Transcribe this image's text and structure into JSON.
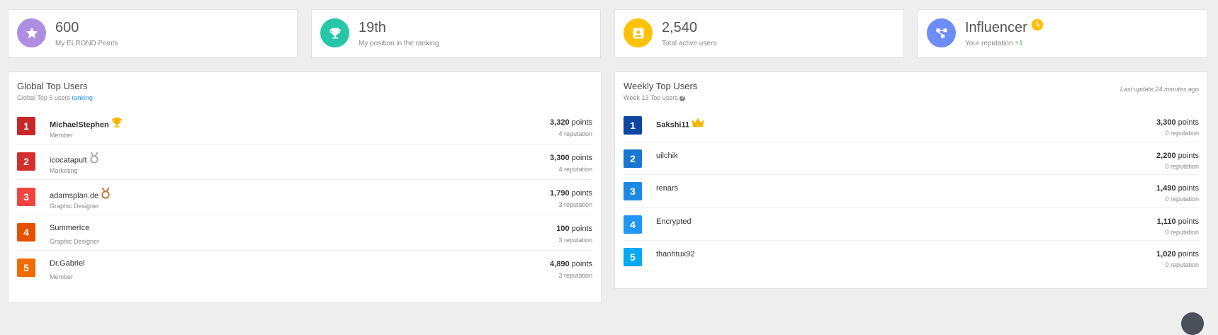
{
  "stats": [
    {
      "value": "600",
      "label": "My ELROND Points",
      "color": "#ae8ee0",
      "icon": "star-icon"
    },
    {
      "value": "19th",
      "label": "My position in the ranking",
      "color": "#26c6a6",
      "icon": "trophy-icon"
    },
    {
      "value": "2,540",
      "label": "Total active users",
      "color": "#ffc107",
      "icon": "user-icon"
    },
    {
      "value": "Influencer",
      "label": "Your reputation",
      "delta": "+1",
      "color": "#6d8cf7",
      "icon": "hierarchy-icon",
      "badge_icon": "clock-icon"
    }
  ],
  "global": {
    "title": "Global Top Users",
    "subtitle_prefix": "Global Top 5 users",
    "subtitle_link": "ranking",
    "users": [
      {
        "rank": "1",
        "name": "MichaelStephen",
        "role": "Member",
        "points": "3,320",
        "points_unit": "points",
        "reputation": "4 reputation",
        "color": "#c62828",
        "icon": "trophy-icon",
        "icon_color": "#f5b400"
      },
      {
        "rank": "2",
        "name": "icocatapult",
        "role": "Marketing",
        "points": "3,300",
        "points_unit": "points",
        "reputation": "4 reputation",
        "color": "#d32f2f",
        "icon": "medal-silver-icon",
        "icon_color": "#aaaaaa"
      },
      {
        "rank": "3",
        "name": "adamsplan.de",
        "role": "Graphic Designer",
        "points": "1,790",
        "points_unit": "points",
        "reputation": "3 reputation",
        "color": "#f4433f",
        "icon": "medal-bronze-icon",
        "icon_color": "#c07a3b"
      },
      {
        "rank": "4",
        "name": "SummerIce",
        "role": "Graphic Designer",
        "points": "100",
        "points_unit": "points",
        "reputation": "3 reputation",
        "color": "#e65100",
        "icon": "",
        "icon_color": ""
      },
      {
        "rank": "5",
        "name": "Dr.Gabriel",
        "role": "Member",
        "points": "4,890",
        "points_unit": "points",
        "reputation": "2 reputation",
        "color": "#ef6c00",
        "icon": "",
        "icon_color": ""
      }
    ]
  },
  "weekly": {
    "title": "Weekly Top Users",
    "subtitle": "Week 13 Top users",
    "last_update": "Last update 24 minutes ago",
    "users": [
      {
        "rank": "1",
        "name": "Sakshi11",
        "points": "3,300",
        "points_unit": "points",
        "reputation": "0 reputation",
        "color": "#0d47a1",
        "icon": "crown-icon",
        "icon_color": "#f5b400"
      },
      {
        "rank": "2",
        "name": "uilchik",
        "points": "2,200",
        "points_unit": "points",
        "reputation": "0 reputation",
        "color": "#1976d2",
        "icon": "",
        "icon_color": ""
      },
      {
        "rank": "3",
        "name": "renars",
        "points": "1,490",
        "points_unit": "points",
        "reputation": "0 reputation",
        "color": "#1e88e5",
        "icon": "",
        "icon_color": ""
      },
      {
        "rank": "4",
        "name": "Encrypted",
        "points": "1,110",
        "points_unit": "points",
        "reputation": "0 reputation",
        "color": "#2196f3",
        "icon": "",
        "icon_color": ""
      },
      {
        "rank": "5",
        "name": "thanhtux92",
        "points": "1,020",
        "points_unit": "points",
        "reputation": "0 reputation",
        "color": "#03a9f4",
        "icon": "",
        "icon_color": ""
      }
    ]
  }
}
